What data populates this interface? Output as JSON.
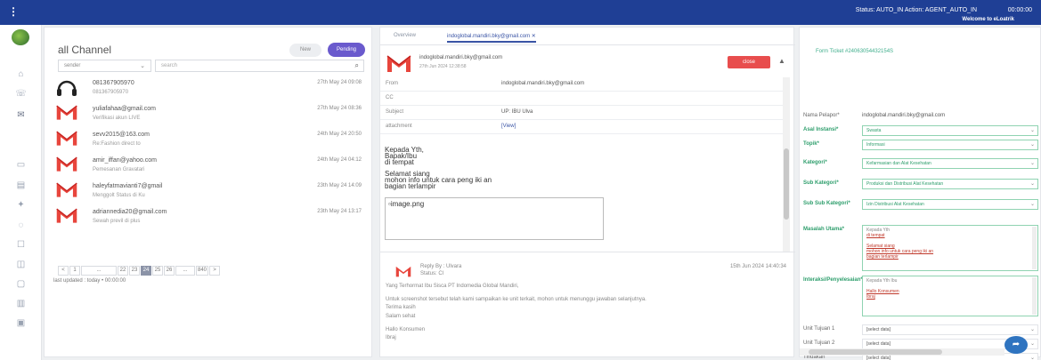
{
  "topbar": {
    "menu_icon": "⋮",
    "status": "Status: AUTO_IN Action: AGENT_AUTO_IN",
    "clock": "00:00:00",
    "welcome": "Welcome to eLoatrik"
  },
  "channel_list": {
    "title": "all Channel",
    "toggle_new": "New",
    "toggle_pending": "Pending",
    "filter": {
      "value": "sender",
      "chevron": "⌄"
    },
    "search": {
      "placeholder": "search",
      "icon": "search-icon"
    },
    "items": [
      {
        "name": "081367905970",
        "sub": "081367905970",
        "time": "27th May 24 09:08",
        "channel": "phone"
      },
      {
        "name": "yuliafahaa@gmail.com",
        "sub": "Verifikasi akun LIVE",
        "time": "27th May 24 08:36",
        "channel": "email"
      },
      {
        "name": "sevv2015@163.com",
        "sub": "Re:Fashion direct to",
        "time": "24th May 24 20:50",
        "channel": "email"
      },
      {
        "name": "amir_iffan@yahoo.com",
        "sub": "Pemesanan Gravatari",
        "time": "24th May 24 04:12",
        "channel": "email"
      },
      {
        "name": "haleyfatmavianti7@gmail",
        "sub": "Menggolt Status di Ku",
        "time": "23th May 24 14:09",
        "channel": "email"
      },
      {
        "name": "adriannedia20@gmail.com",
        "sub": "Sewah previl di plus",
        "time": "23th May 24 13:17",
        "channel": "email"
      }
    ],
    "pager": [
      "<",
      "1",
      "...",
      "22",
      "23",
      "24",
      "25",
      "26",
      "...",
      "840",
      ">"
    ],
    "pager_active": "24",
    "last_updated": "last updated : today • 00:00:00"
  },
  "viewer": {
    "tab_overview": "Overview",
    "tab_email": "indoglobal.mandiri.bky@gmail.com ✕",
    "from_address": "indoglobal.mandiri.bky@gmail.com",
    "date": "27th Jun 2024 12:38:58",
    "close_label": "close",
    "up_icon": "▲",
    "headers": [
      {
        "key": "From",
        "value": "indoglobal.mandiri.bky@gmail.com",
        "link": false
      },
      {
        "key": "CC",
        "value": "",
        "link": false
      },
      {
        "key": "Subject",
        "value": "UP: IBU Ulva",
        "link": false
      },
      {
        "key": "attachment",
        "value": "[View]",
        "link": true
      }
    ],
    "body_lines": [
      "Kepada Yth,",
      "Bapak/Ibu",
      "di tempat",
      "",
      "Selamat siang",
      "mohon info untuk cara peng iki an",
      "bagian terlampir"
    ],
    "attachment_name": "image.png",
    "reply": {
      "by": "Reply By : Ulvara",
      "status": "Status: Cl",
      "date": "15th Jun 2024 14:40:34",
      "lines": [
        "Yang Terhormat Ibu Sisca PT Indomedia Global Mandiri,",
        "",
        "Untuk screenshot tersebut telah kami sampaikan ke unit terkait, mohon untuk menunggu jawaban selanjutnya.",
        "Terima kasih",
        "Salam sehat",
        "",
        "Hallo Konsumen",
        "Ibraj"
      ]
    }
  },
  "form": {
    "title": "Form Ticket #24063054432154S",
    "fields": [
      {
        "label": "Nama Pelapor*",
        "type": "text",
        "value": "indoglobal.mandiri.bky@gmail.com",
        "accent": false
      },
      {
        "label": "Asal Instansi*",
        "type": "select",
        "value": "Swasta",
        "accent": true
      },
      {
        "label": "Topik*",
        "type": "select",
        "value": "Informasi",
        "accent": true
      },
      {
        "label": "Kategori*",
        "type": "select",
        "value": "Kefarmasian dan Alat Kesehatan",
        "accent": true
      },
      {
        "label": "Sub Kategori*",
        "type": "select",
        "value": "Produksi dan Distribusi Alat Kesehatan",
        "accent": true
      },
      {
        "label": "Sub Sub Kategori*",
        "type": "select",
        "value": "Izin Distribusi Alat Kesehatan",
        "accent": true
      }
    ],
    "masalah_label": "Masalah Utama*",
    "masalah_lines": [
      "Kepada Yth",
      "di tempat",
      "",
      "Selamat siang",
      "mohon info untuk cara peng iki an",
      "bagian terlampir"
    ],
    "interaksi_label": "Interaksi/Penyelesaian*",
    "interaksi_lines": [
      "Kepada Yth Ibu",
      "",
      "Hallo Konsumen",
      "Ibraj"
    ],
    "unit_fields": [
      {
        "label": "Unit Tujuan 1",
        "value": "[select data]"
      },
      {
        "label": "Unit Tujuan 2",
        "value": "[select data]"
      },
      {
        "label": "Tindakan",
        "value": "[select data]"
      }
    ],
    "fab_icon": "➦"
  },
  "colors": {
    "topbar": "#1f3f95",
    "accent_green": "#2e9e6c",
    "pending": "#6a5acd",
    "close_btn": "#e84d4d"
  }
}
